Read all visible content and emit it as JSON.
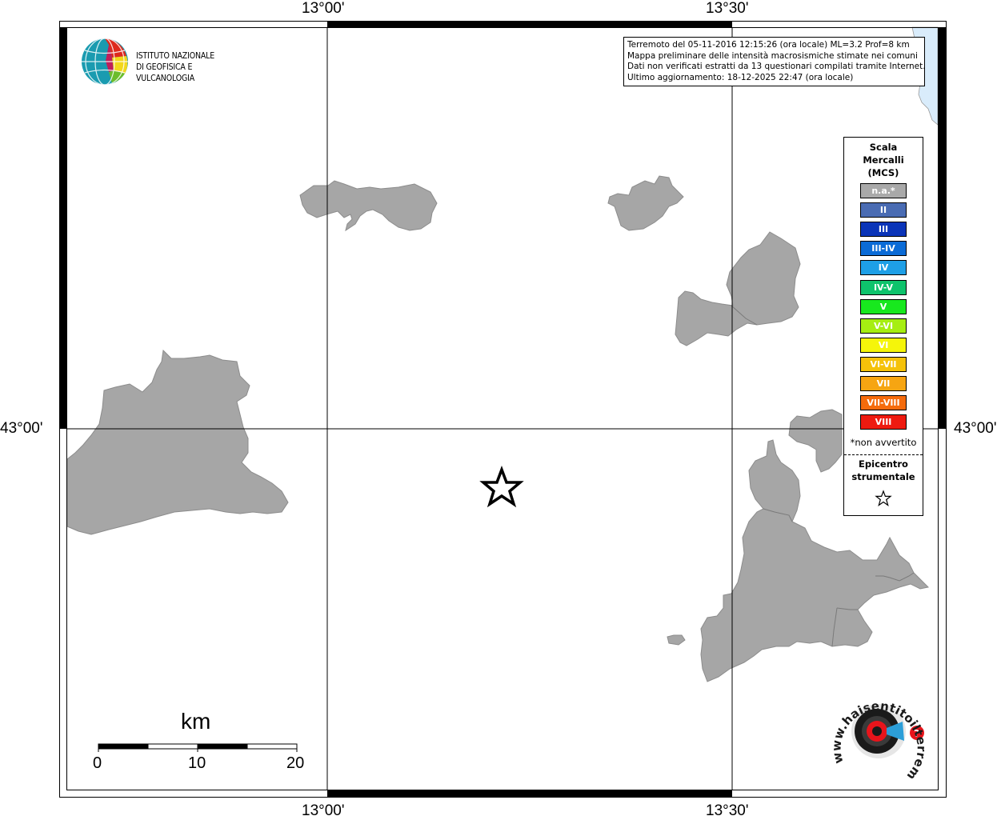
{
  "map": {
    "coordinates": {
      "lon_left": "13°00'",
      "lon_right": "13°30'",
      "lat": "43°00'"
    },
    "info": {
      "line1": "Terremoto del 05-11-2016 12:15:26 (ora locale) ML=3.2 Prof=8 km",
      "line2": "Mappa preliminare delle intensità macrosismiche stimate nei comuni",
      "line3": "Dati non verificati estratti da 13 questionari compilati tramite Internet.",
      "line4": "Ultimo aggiornamento: 18-12-2025 22:47 (ora locale)"
    },
    "legend": {
      "title1": "Scala",
      "title2": "Mercalli",
      "title3": "(MCS)",
      "items": [
        {
          "label": "n.a.*",
          "color": "#a9a9a9"
        },
        {
          "label": "II",
          "color": "#4a6cb3"
        },
        {
          "label": "III",
          "color": "#0a34b8"
        },
        {
          "label": "III-IV",
          "color": "#0b6bd6"
        },
        {
          "label": "IV",
          "color": "#1e9fe6"
        },
        {
          "label": "IV-V",
          "color": "#0ec36c"
        },
        {
          "label": "V",
          "color": "#18e81e"
        },
        {
          "label": "V-VI",
          "color": "#a6ee12"
        },
        {
          "label": "VI",
          "color": "#f5f50a"
        },
        {
          "label": "VI-VII",
          "color": "#f5c20a"
        },
        {
          "label": "VII",
          "color": "#f6a512"
        },
        {
          "label": "VII-VIII",
          "color": "#f56b0c"
        },
        {
          "label": "VIII",
          "color": "#ee1a10"
        }
      ],
      "note": "*non avvertito",
      "epicenter_label1": "Epicentro",
      "epicenter_label2": "strumentale"
    },
    "logo": {
      "line1": "ISTITUTO NAZIONALE",
      "line2": "DI GEOFISICA E VULCANOLOGIA"
    },
    "scalebar": {
      "unit": "km",
      "labels": [
        "0",
        "10",
        "20"
      ]
    },
    "hsit_logo": {
      "text": "www.haisentitoilterremoto.it"
    },
    "colors": {
      "land": "#a6a6a6",
      "sea": "#d9ecfb",
      "frame": "#000000"
    }
  }
}
